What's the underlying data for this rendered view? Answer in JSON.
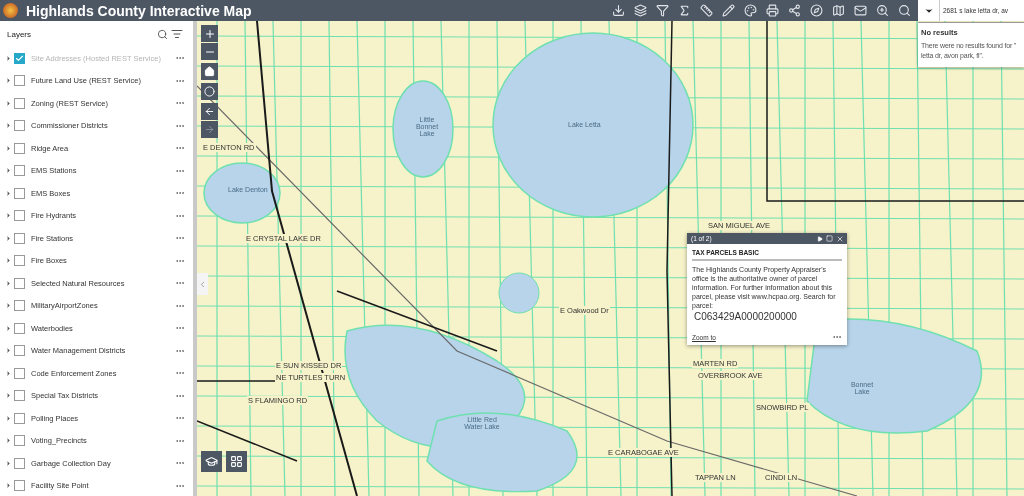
{
  "header": {
    "title": "Highlands County Interactive Map"
  },
  "search": {
    "value": "2681 s lake letta dr, av",
    "results_title": "No results",
    "results_lines": [
      "There were no results found for \"",
      "letta dr, avon park, fl\"."
    ]
  },
  "layers": {
    "title": "Layers",
    "items": [
      {
        "label": "Site Addresses (Hosted REST Service)",
        "checked": true,
        "dimmed": true
      },
      {
        "label": "Future Land Use (REST Service)",
        "checked": false,
        "dimmed": false
      },
      {
        "label": "Zoning (REST Service)",
        "checked": false,
        "dimmed": false
      },
      {
        "label": "Commissioner Districts",
        "checked": false,
        "dimmed": false
      },
      {
        "label": "Ridge Area",
        "checked": false,
        "dimmed": false
      },
      {
        "label": "EMS Stations",
        "checked": false,
        "dimmed": false
      },
      {
        "label": "EMS Boxes",
        "checked": false,
        "dimmed": false
      },
      {
        "label": "Fire Hydrants",
        "checked": false,
        "dimmed": false
      },
      {
        "label": "Fire Stations",
        "checked": false,
        "dimmed": false
      },
      {
        "label": "Fire Boxes",
        "checked": false,
        "dimmed": false
      },
      {
        "label": "Selected Natural Resources",
        "checked": false,
        "dimmed": false
      },
      {
        "label": "MilitaryAirportZones",
        "checked": false,
        "dimmed": false
      },
      {
        "label": "Waterbodies",
        "checked": false,
        "dimmed": false
      },
      {
        "label": "Water Management Districts",
        "checked": false,
        "dimmed": false
      },
      {
        "label": "Code Enforcement Zones",
        "checked": false,
        "dimmed": false
      },
      {
        "label": "Special Tax Districts",
        "checked": false,
        "dimmed": false
      },
      {
        "label": "Polling Places",
        "checked": false,
        "dimmed": false
      },
      {
        "label": "Voting_Precincts",
        "checked": false,
        "dimmed": false
      },
      {
        "label": "Garbage Collection Day",
        "checked": false,
        "dimmed": false
      },
      {
        "label": "Facility Site Point",
        "checked": false,
        "dimmed": false
      }
    ]
  },
  "map": {
    "lake_labels": [
      "Lake Letta",
      "Little Bonnet Lake",
      "Lake Denton",
      "Little Red Water Lake",
      "Bonnet Lake"
    ],
    "street_labels": [
      "E DENTON RD",
      "E CRYSTAL LAKE DR",
      "E SUN KISSED DR",
      "NE TURTLES TURN",
      "S FLAMINGO RD",
      "E Oakwood Dr",
      "SAN MIGUEL AVE",
      "MARTEN RD",
      "OVERBROOK AVE",
      "SNOWBIRD PL",
      "E CARABOGAE AVE",
      "TAPPAN LN",
      "CINDI LN"
    ],
    "forward_disabled": true
  },
  "popup": {
    "counter": "(1 of 2)",
    "title": "TAX PARCELS BASIC",
    "body": "The Highlands County Property Appraiser's office is the authoritative owner of parcel information. For further information about this parcel, please visit www.hcpao.org. Search for parcel:",
    "parcel": "C063429A0000200000",
    "zoom_link": "Zoom to"
  }
}
